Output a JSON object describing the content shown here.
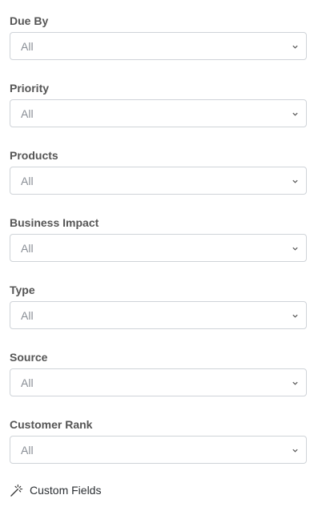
{
  "filters": [
    {
      "label": "Due By",
      "value": "All"
    },
    {
      "label": "Priority",
      "value": "All"
    },
    {
      "label": "Products",
      "value": "All"
    },
    {
      "label": "Business Impact",
      "value": "All"
    },
    {
      "label": "Type",
      "value": "All"
    },
    {
      "label": "Source",
      "value": "All"
    },
    {
      "label": "Customer Rank",
      "value": "All"
    }
  ],
  "custom_fields": {
    "label": "Custom Fields",
    "icon": "magic-wand-icon"
  },
  "colors": {
    "label_text": "#555555",
    "select_border": "#cfd3d8",
    "select_value_text": "#8a8f96",
    "link_text": "#2b2f33"
  }
}
